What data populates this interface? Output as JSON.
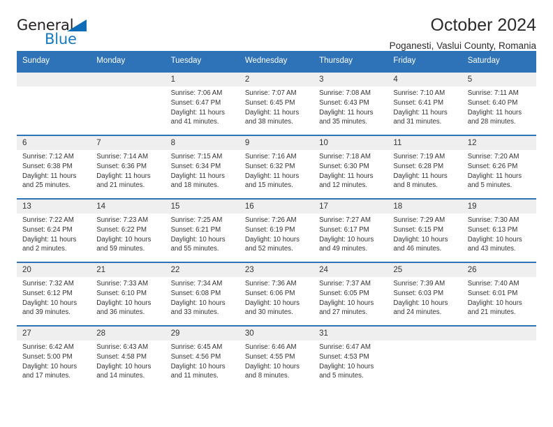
{
  "brand": {
    "word_one": "General",
    "word_two": "Blue",
    "triangle": "triangle-icon"
  },
  "header": {
    "title": "October 2024",
    "subtitle": "Poganesti, Vaslui County, Romania"
  },
  "colors": {
    "header_blue": "#2e72b8",
    "day_band_gray": "#efefef",
    "brand_blue": "#1878be",
    "text": "#333333"
  },
  "weekday_headers": [
    "Sunday",
    "Monday",
    "Tuesday",
    "Wednesday",
    "Thursday",
    "Friday",
    "Saturday"
  ],
  "labels": {
    "sunrise_prefix": "Sunrise:",
    "sunset_prefix": "Sunset:",
    "daylight_prefix": "Daylight:"
  },
  "weeks": [
    [
      {
        "day": "",
        "sunrise": "",
        "sunset": "",
        "daylight_1": "",
        "daylight_2": ""
      },
      {
        "day": "",
        "sunrise": "",
        "sunset": "",
        "daylight_1": "",
        "daylight_2": ""
      },
      {
        "day": "1",
        "sunrise": "Sunrise: 7:06 AM",
        "sunset": "Sunset: 6:47 PM",
        "daylight_1": "Daylight: 11 hours",
        "daylight_2": "and 41 minutes."
      },
      {
        "day": "2",
        "sunrise": "Sunrise: 7:07 AM",
        "sunset": "Sunset: 6:45 PM",
        "daylight_1": "Daylight: 11 hours",
        "daylight_2": "and 38 minutes."
      },
      {
        "day": "3",
        "sunrise": "Sunrise: 7:08 AM",
        "sunset": "Sunset: 6:43 PM",
        "daylight_1": "Daylight: 11 hours",
        "daylight_2": "and 35 minutes."
      },
      {
        "day": "4",
        "sunrise": "Sunrise: 7:10 AM",
        "sunset": "Sunset: 6:41 PM",
        "daylight_1": "Daylight: 11 hours",
        "daylight_2": "and 31 minutes."
      },
      {
        "day": "5",
        "sunrise": "Sunrise: 7:11 AM",
        "sunset": "Sunset: 6:40 PM",
        "daylight_1": "Daylight: 11 hours",
        "daylight_2": "and 28 minutes."
      }
    ],
    [
      {
        "day": "6",
        "sunrise": "Sunrise: 7:12 AM",
        "sunset": "Sunset: 6:38 PM",
        "daylight_1": "Daylight: 11 hours",
        "daylight_2": "and 25 minutes."
      },
      {
        "day": "7",
        "sunrise": "Sunrise: 7:14 AM",
        "sunset": "Sunset: 6:36 PM",
        "daylight_1": "Daylight: 11 hours",
        "daylight_2": "and 21 minutes."
      },
      {
        "day": "8",
        "sunrise": "Sunrise: 7:15 AM",
        "sunset": "Sunset: 6:34 PM",
        "daylight_1": "Daylight: 11 hours",
        "daylight_2": "and 18 minutes."
      },
      {
        "day": "9",
        "sunrise": "Sunrise: 7:16 AM",
        "sunset": "Sunset: 6:32 PM",
        "daylight_1": "Daylight: 11 hours",
        "daylight_2": "and 15 minutes."
      },
      {
        "day": "10",
        "sunrise": "Sunrise: 7:18 AM",
        "sunset": "Sunset: 6:30 PM",
        "daylight_1": "Daylight: 11 hours",
        "daylight_2": "and 12 minutes."
      },
      {
        "day": "11",
        "sunrise": "Sunrise: 7:19 AM",
        "sunset": "Sunset: 6:28 PM",
        "daylight_1": "Daylight: 11 hours",
        "daylight_2": "and 8 minutes."
      },
      {
        "day": "12",
        "sunrise": "Sunrise: 7:20 AM",
        "sunset": "Sunset: 6:26 PM",
        "daylight_1": "Daylight: 11 hours",
        "daylight_2": "and 5 minutes."
      }
    ],
    [
      {
        "day": "13",
        "sunrise": "Sunrise: 7:22 AM",
        "sunset": "Sunset: 6:24 PM",
        "daylight_1": "Daylight: 11 hours",
        "daylight_2": "and 2 minutes."
      },
      {
        "day": "14",
        "sunrise": "Sunrise: 7:23 AM",
        "sunset": "Sunset: 6:22 PM",
        "daylight_1": "Daylight: 10 hours",
        "daylight_2": "and 59 minutes."
      },
      {
        "day": "15",
        "sunrise": "Sunrise: 7:25 AM",
        "sunset": "Sunset: 6:21 PM",
        "daylight_1": "Daylight: 10 hours",
        "daylight_2": "and 55 minutes."
      },
      {
        "day": "16",
        "sunrise": "Sunrise: 7:26 AM",
        "sunset": "Sunset: 6:19 PM",
        "daylight_1": "Daylight: 10 hours",
        "daylight_2": "and 52 minutes."
      },
      {
        "day": "17",
        "sunrise": "Sunrise: 7:27 AM",
        "sunset": "Sunset: 6:17 PM",
        "daylight_1": "Daylight: 10 hours",
        "daylight_2": "and 49 minutes."
      },
      {
        "day": "18",
        "sunrise": "Sunrise: 7:29 AM",
        "sunset": "Sunset: 6:15 PM",
        "daylight_1": "Daylight: 10 hours",
        "daylight_2": "and 46 minutes."
      },
      {
        "day": "19",
        "sunrise": "Sunrise: 7:30 AM",
        "sunset": "Sunset: 6:13 PM",
        "daylight_1": "Daylight: 10 hours",
        "daylight_2": "and 43 minutes."
      }
    ],
    [
      {
        "day": "20",
        "sunrise": "Sunrise: 7:32 AM",
        "sunset": "Sunset: 6:12 PM",
        "daylight_1": "Daylight: 10 hours",
        "daylight_2": "and 39 minutes."
      },
      {
        "day": "21",
        "sunrise": "Sunrise: 7:33 AM",
        "sunset": "Sunset: 6:10 PM",
        "daylight_1": "Daylight: 10 hours",
        "daylight_2": "and 36 minutes."
      },
      {
        "day": "22",
        "sunrise": "Sunrise: 7:34 AM",
        "sunset": "Sunset: 6:08 PM",
        "daylight_1": "Daylight: 10 hours",
        "daylight_2": "and 33 minutes."
      },
      {
        "day": "23",
        "sunrise": "Sunrise: 7:36 AM",
        "sunset": "Sunset: 6:06 PM",
        "daylight_1": "Daylight: 10 hours",
        "daylight_2": "and 30 minutes."
      },
      {
        "day": "24",
        "sunrise": "Sunrise: 7:37 AM",
        "sunset": "Sunset: 6:05 PM",
        "daylight_1": "Daylight: 10 hours",
        "daylight_2": "and 27 minutes."
      },
      {
        "day": "25",
        "sunrise": "Sunrise: 7:39 AM",
        "sunset": "Sunset: 6:03 PM",
        "daylight_1": "Daylight: 10 hours",
        "daylight_2": "and 24 minutes."
      },
      {
        "day": "26",
        "sunrise": "Sunrise: 7:40 AM",
        "sunset": "Sunset: 6:01 PM",
        "daylight_1": "Daylight: 10 hours",
        "daylight_2": "and 21 minutes."
      }
    ],
    [
      {
        "day": "27",
        "sunrise": "Sunrise: 6:42 AM",
        "sunset": "Sunset: 5:00 PM",
        "daylight_1": "Daylight: 10 hours",
        "daylight_2": "and 17 minutes."
      },
      {
        "day": "28",
        "sunrise": "Sunrise: 6:43 AM",
        "sunset": "Sunset: 4:58 PM",
        "daylight_1": "Daylight: 10 hours",
        "daylight_2": "and 14 minutes."
      },
      {
        "day": "29",
        "sunrise": "Sunrise: 6:45 AM",
        "sunset": "Sunset: 4:56 PM",
        "daylight_1": "Daylight: 10 hours",
        "daylight_2": "and 11 minutes."
      },
      {
        "day": "30",
        "sunrise": "Sunrise: 6:46 AM",
        "sunset": "Sunset: 4:55 PM",
        "daylight_1": "Daylight: 10 hours",
        "daylight_2": "and 8 minutes."
      },
      {
        "day": "31",
        "sunrise": "Sunrise: 6:47 AM",
        "sunset": "Sunset: 4:53 PM",
        "daylight_1": "Daylight: 10 hours",
        "daylight_2": "and 5 minutes."
      },
      {
        "day": "",
        "sunrise": "",
        "sunset": "",
        "daylight_1": "",
        "daylight_2": ""
      },
      {
        "day": "",
        "sunrise": "",
        "sunset": "",
        "daylight_1": "",
        "daylight_2": ""
      }
    ]
  ]
}
